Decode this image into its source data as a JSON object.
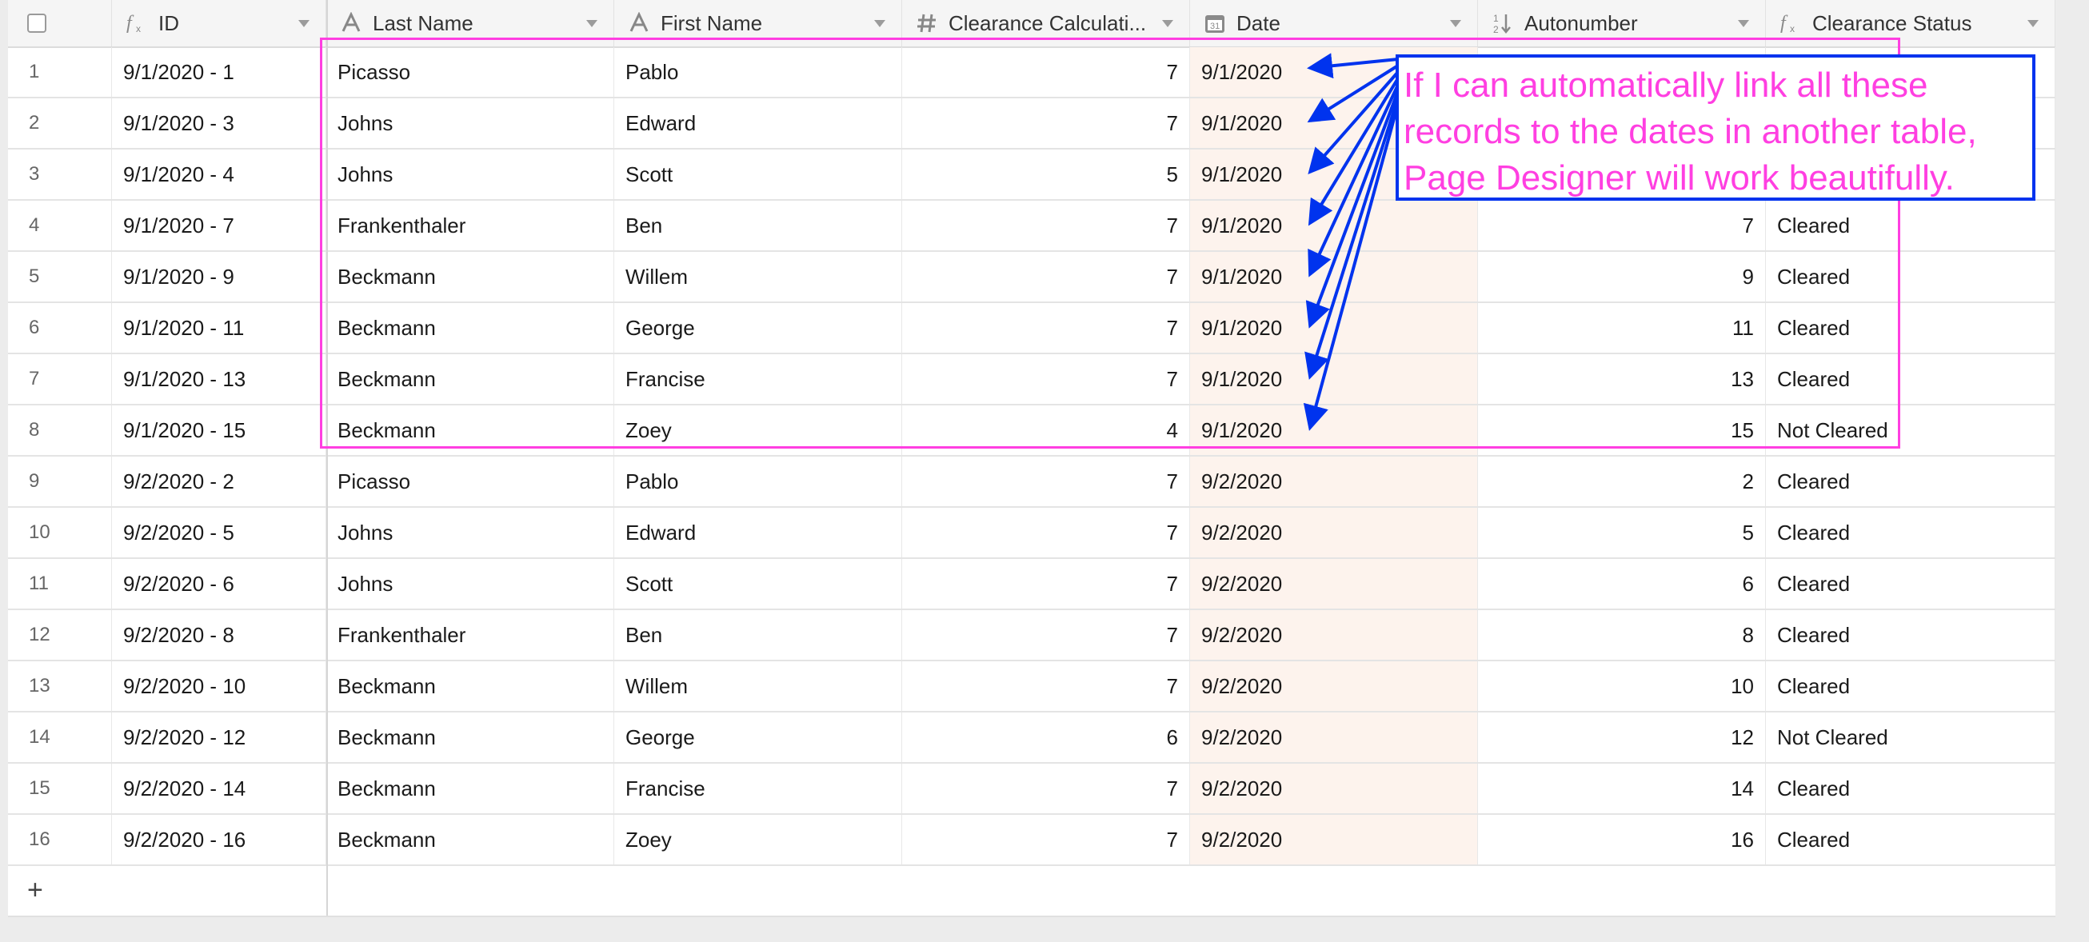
{
  "header": {
    "columns": [
      {
        "label": "ID",
        "icon": "formula-icon"
      },
      {
        "label": "Last Name",
        "icon": "text-icon"
      },
      {
        "label": "First Name",
        "icon": "text-icon"
      },
      {
        "label": "Clearance Calculati...",
        "icon": "number-icon"
      },
      {
        "label": "Date",
        "icon": "calendar-icon"
      },
      {
        "label": "Autonumber",
        "icon": "autonumber-icon"
      },
      {
        "label": "Clearance Status",
        "icon": "formula-icon"
      }
    ]
  },
  "rows": [
    {
      "n": "1",
      "id": "9/1/2020 - 1",
      "last": "Picasso",
      "first": "Pablo",
      "calc": "7",
      "date": "9/1/2020",
      "auto": "",
      "status": ""
    },
    {
      "n": "2",
      "id": "9/1/2020 - 3",
      "last": "Johns",
      "first": "Edward",
      "calc": "7",
      "date": "9/1/2020",
      "auto": "",
      "status": ""
    },
    {
      "n": "3",
      "id": "9/1/2020 - 4",
      "last": "Johns",
      "first": "Scott",
      "calc": "5",
      "date": "9/1/2020",
      "auto": "",
      "status": ""
    },
    {
      "n": "4",
      "id": "9/1/2020 - 7",
      "last": "Frankenthaler",
      "first": "Ben",
      "calc": "7",
      "date": "9/1/2020",
      "auto": "7",
      "status": "Cleared"
    },
    {
      "n": "5",
      "id": "9/1/2020 - 9",
      "last": "Beckmann",
      "first": "Willem",
      "calc": "7",
      "date": "9/1/2020",
      "auto": "9",
      "status": "Cleared"
    },
    {
      "n": "6",
      "id": "9/1/2020 - 11",
      "last": "Beckmann",
      "first": "George",
      "calc": "7",
      "date": "9/1/2020",
      "auto": "11",
      "status": "Cleared"
    },
    {
      "n": "7",
      "id": "9/1/2020 - 13",
      "last": "Beckmann",
      "first": "Francise",
      "calc": "7",
      "date": "9/1/2020",
      "auto": "13",
      "status": "Cleared"
    },
    {
      "n": "8",
      "id": "9/1/2020 - 15",
      "last": "Beckmann",
      "first": "Zoey",
      "calc": "4",
      "date": "9/1/2020",
      "auto": "15",
      "status": "Not Cleared"
    },
    {
      "n": "9",
      "id": "9/2/2020 - 2",
      "last": "Picasso",
      "first": "Pablo",
      "calc": "7",
      "date": "9/2/2020",
      "auto": "2",
      "status": "Cleared"
    },
    {
      "n": "10",
      "id": "9/2/2020 - 5",
      "last": "Johns",
      "first": "Edward",
      "calc": "7",
      "date": "9/2/2020",
      "auto": "5",
      "status": "Cleared"
    },
    {
      "n": "11",
      "id": "9/2/2020 - 6",
      "last": "Johns",
      "first": "Scott",
      "calc": "7",
      "date": "9/2/2020",
      "auto": "6",
      "status": "Cleared"
    },
    {
      "n": "12",
      "id": "9/2/2020 - 8",
      "last": "Frankenthaler",
      "first": "Ben",
      "calc": "7",
      "date": "9/2/2020",
      "auto": "8",
      "status": "Cleared"
    },
    {
      "n": "13",
      "id": "9/2/2020 - 10",
      "last": "Beckmann",
      "first": "Willem",
      "calc": "7",
      "date": "9/2/2020",
      "auto": "10",
      "status": "Cleared"
    },
    {
      "n": "14",
      "id": "9/2/2020 - 12",
      "last": "Beckmann",
      "first": "George",
      "calc": "6",
      "date": "9/2/2020",
      "auto": "12",
      "status": "Not Cleared"
    },
    {
      "n": "15",
      "id": "9/2/2020 - 14",
      "last": "Beckmann",
      "first": "Francise",
      "calc": "7",
      "date": "9/2/2020",
      "auto": "14",
      "status": "Cleared"
    },
    {
      "n": "16",
      "id": "9/2/2020 - 16",
      "last": "Beckmann",
      "first": "Zoey",
      "calc": "7",
      "date": "9/2/2020",
      "auto": "16",
      "status": "Cleared"
    }
  ],
  "add_row": {
    "label": "+"
  },
  "annotation": {
    "lines": [
      "If I can automatically link all these",
      "records to the dates in another table,",
      "Page Designer will work beautifully."
    ],
    "text_color": "#ff3fe1",
    "border_color": "#0033ee",
    "highlight_color": "#ff3fe1"
  },
  "colors": {
    "date_column_bg": "#fdf3ed",
    "header_bg": "#f5f5f5"
  }
}
